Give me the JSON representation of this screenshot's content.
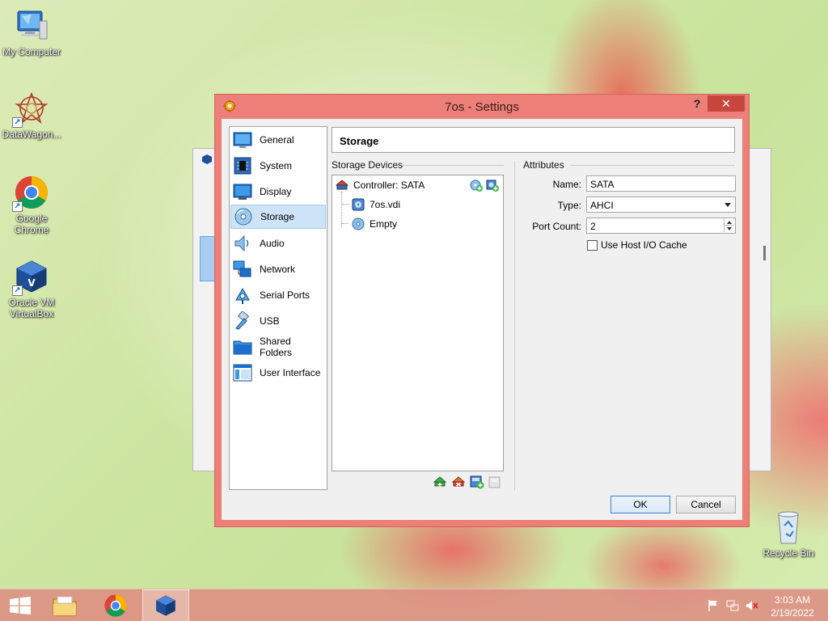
{
  "desktop": {
    "icons": [
      {
        "label": "My Computer"
      },
      {
        "label": "DataWagon..."
      },
      {
        "label": "Google Chrome"
      },
      {
        "label": "Oracle VM VirtualBox"
      },
      {
        "label": "Recycle Bin"
      }
    ]
  },
  "dialog": {
    "title": "7os - Settings",
    "help_label": "?",
    "close_label": "✕",
    "nav": [
      {
        "label": "General",
        "icon": "general-icon"
      },
      {
        "label": "System",
        "icon": "system-icon"
      },
      {
        "label": "Display",
        "icon": "display-icon"
      },
      {
        "label": "Storage",
        "icon": "storage-icon",
        "selected": true
      },
      {
        "label": "Audio",
        "icon": "audio-icon"
      },
      {
        "label": "Network",
        "icon": "network-icon"
      },
      {
        "label": "Serial Ports",
        "icon": "serial-ports-icon"
      },
      {
        "label": "USB",
        "icon": "usb-icon"
      },
      {
        "label": "Shared Folders",
        "icon": "shared-folders-icon"
      },
      {
        "label": "User Interface",
        "icon": "user-interface-icon"
      }
    ],
    "page_title": "Storage",
    "storage_devices": {
      "group_title": "Storage Devices",
      "controller": "Controller: SATA",
      "items": [
        {
          "label": "7os.vdi",
          "icon": "hard-disk-icon"
        },
        {
          "label": "Empty",
          "icon": "optical-disc-icon"
        }
      ]
    },
    "attributes": {
      "group_title": "Attributes",
      "name_label": "Name:",
      "name_value": "SATA",
      "type_label": "Type:",
      "type_value": "AHCI",
      "port_count_label": "Port Count:",
      "port_count_value": "2",
      "host_io_cache_label": "Use Host I/O Cache",
      "host_io_cache_checked": false
    },
    "ok_label": "OK",
    "cancel_label": "Cancel"
  },
  "taskbar": {
    "time": "3:03 AM",
    "date": "2/19/2022"
  },
  "colors": {
    "dialog_frame": "#ec7f78",
    "close_button": "#c7473f",
    "selection": "#cde3f7"
  }
}
